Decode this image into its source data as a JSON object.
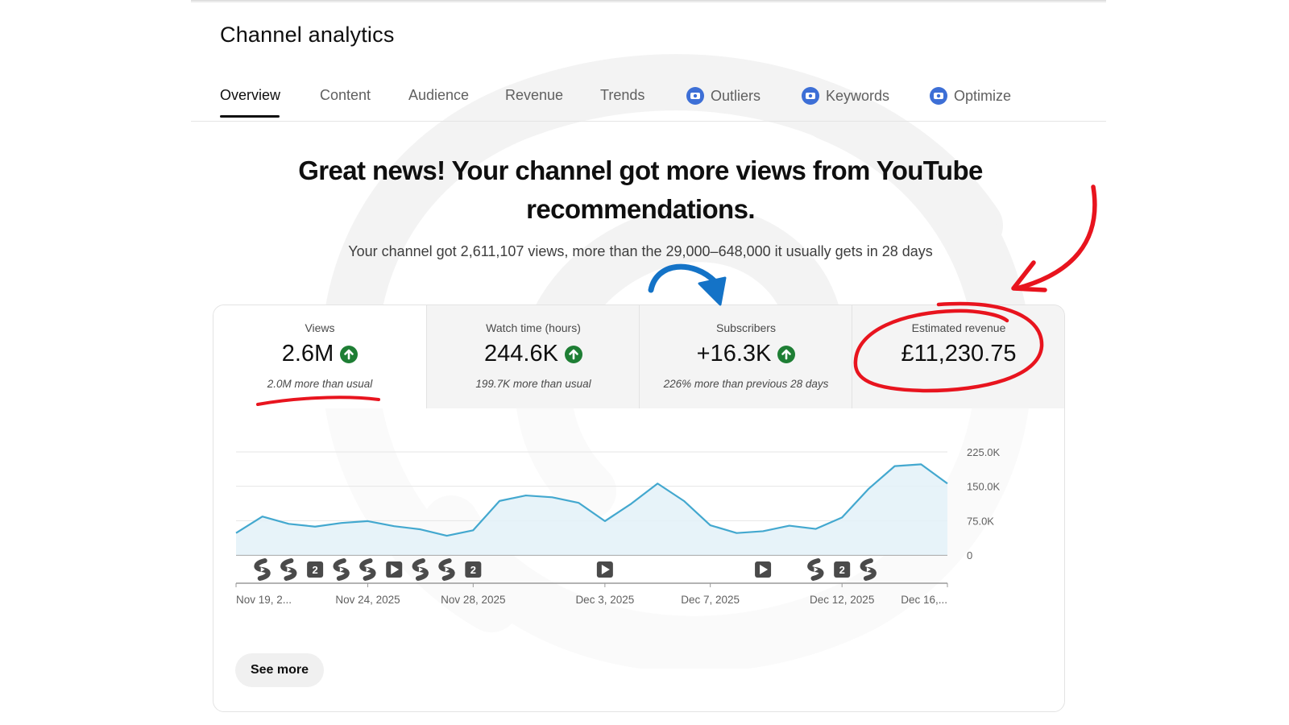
{
  "page_title": "Channel analytics",
  "tabs": [
    {
      "label": "Overview",
      "active": true,
      "icon": null
    },
    {
      "label": "Content",
      "active": false,
      "icon": null
    },
    {
      "label": "Audience",
      "active": false,
      "icon": null
    },
    {
      "label": "Revenue",
      "active": false,
      "icon": null
    },
    {
      "label": "Trends",
      "active": false,
      "icon": null
    },
    {
      "label": "Outliers",
      "active": false,
      "icon": "extension-icon"
    },
    {
      "label": "Keywords",
      "active": false,
      "icon": "extension-icon"
    },
    {
      "label": "Optimize",
      "active": false,
      "icon": "extension-icon"
    }
  ],
  "headline": {
    "line1": "Great news! Your channel got more views from YouTube",
    "line2": "recommendations.",
    "subtext": "Your channel got 2,611,107 views, more than the 29,000–648,000 it usually gets in 28 days"
  },
  "metrics": [
    {
      "label": "Views",
      "value": "2.6M",
      "trend": "up",
      "note": "2.0M more than usual",
      "selected": true
    },
    {
      "label": "Watch time (hours)",
      "value": "244.6K",
      "trend": "up",
      "note": "199.7K more than usual",
      "selected": false
    },
    {
      "label": "Subscribers",
      "value": "+16.3K",
      "trend": "up",
      "note": "226% more than previous 28 days",
      "selected": false
    },
    {
      "label": "Estimated revenue",
      "value": "£11,230.75",
      "trend": null,
      "note": "",
      "selected": false
    }
  ],
  "chart_data": {
    "type": "area",
    "y_ticks": [
      "225.0K",
      "150.0K",
      "75.0K",
      "0"
    ],
    "ylim": [
      0,
      225000
    ],
    "x_tick_labels": [
      "Nov 19, 2...",
      "Nov 24, 2025",
      "Nov 28, 2025",
      "Dec 3, 2025",
      "Dec 7, 2025",
      "Dec 12, 2025",
      "Dec 16,..."
    ],
    "x_tick_days": [
      0,
      5,
      9,
      14,
      18,
      23,
      27
    ],
    "values": [
      48000,
      84000,
      68000,
      62000,
      70000,
      74000,
      63000,
      56000,
      42000,
      54000,
      118000,
      130000,
      126000,
      114000,
      74000,
      112000,
      156000,
      118000,
      65000,
      48000,
      52000,
      64000,
      57000,
      82000,
      144000,
      194000,
      198000,
      156000
    ],
    "area_color": "#e3f1f8",
    "line_color": "#43a8cf",
    "markers": [
      {
        "day": 1,
        "type": "short-icon"
      },
      {
        "day": 2,
        "type": "short-icon"
      },
      {
        "day": 3,
        "type": "count",
        "label": "2"
      },
      {
        "day": 4,
        "type": "short-icon"
      },
      {
        "day": 5,
        "type": "short-icon"
      },
      {
        "day": 6,
        "type": "video-icon"
      },
      {
        "day": 7,
        "type": "short-icon"
      },
      {
        "day": 8,
        "type": "short-icon"
      },
      {
        "day": 9,
        "type": "count",
        "label": "2"
      },
      {
        "day": 14,
        "type": "video-icon"
      },
      {
        "day": 20,
        "type": "video-icon"
      },
      {
        "day": 22,
        "type": "short-icon"
      },
      {
        "day": 23,
        "type": "count",
        "label": "2"
      },
      {
        "day": 24,
        "type": "short-icon"
      }
    ]
  },
  "see_more_label": "See more",
  "colors": {
    "trend_up": "#1e7e34",
    "annotation_red": "#e8141e",
    "annotation_blue": "#1473c7",
    "tab_extension": "#3d6fd6"
  }
}
